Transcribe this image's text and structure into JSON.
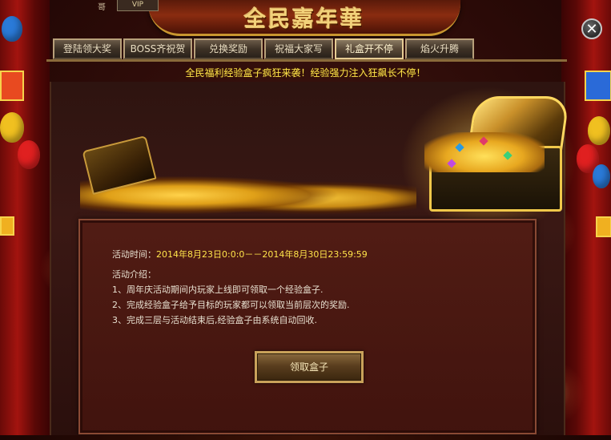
{
  "header": {
    "title": "全民嘉年華",
    "vip_prefix": "哥",
    "vip_label": "VIP"
  },
  "close_button": {
    "label": "✕",
    "icon": "close-icon"
  },
  "tabs": [
    {
      "label": "登陆领大奖",
      "active": false
    },
    {
      "label": "BOSS齐祝贺",
      "active": false
    },
    {
      "label": "兑换奖励",
      "active": false
    },
    {
      "label": "祝福大家写",
      "active": false
    },
    {
      "label": "礼盒开不停",
      "active": true
    },
    {
      "label": "焰火升腾",
      "active": false
    }
  ],
  "announcement": "全民福利经验盒子疯狂来袭！经验强力注入狂飙长不停！",
  "activity": {
    "time_label": "活动时间：",
    "time_value": "2014年8月23日0:0:0－－2014年8月30日23:59:59",
    "intro_title": "活动介绍：",
    "rules": [
      "1、周年庆活动期间内玩家上线即可领取一个经验盒子.",
      "2、完成经验盒子给予目标的玩家都可以领取当前层次的奖励.",
      "3、完成三层与活动结束后,经验盒子由系统自动回收."
    ]
  },
  "claim_button": {
    "label": "领取盒子"
  },
  "colors": {
    "accent_gold": "#ffe44a",
    "panel_border": "#8a4a34",
    "curtain_red": "#a3140f"
  },
  "decorations": {
    "treasure_left": "coin-pile-icon",
    "treasure_right": "treasure-chest-icon",
    "side_decor": [
      "balloon-icon",
      "gift-box-icon",
      "firework-icon"
    ]
  }
}
